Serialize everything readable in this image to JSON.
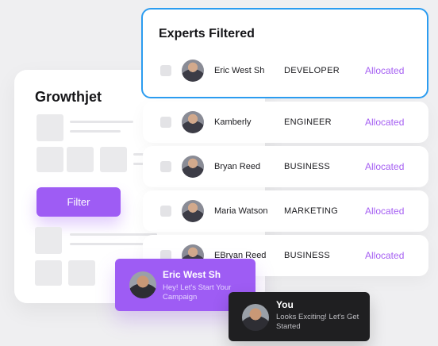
{
  "app": {
    "title": "Growthjet",
    "filter_button": "Filter"
  },
  "experts": {
    "title": "Experts Filtered",
    "rows": [
      {
        "name": "Eric West Sh",
        "role": "DEVELOPER",
        "status": "Allocated"
      },
      {
        "name": "Kamberly",
        "role": "ENGINEER",
        "status": "Allocated"
      },
      {
        "name": "Bryan Reed",
        "role": "BUSINESS",
        "status": "Allocated"
      },
      {
        "name": "Maria Watson",
        "role": "MARKETING",
        "status": "Allocated"
      },
      {
        "name": "EBryan Reed",
        "role": "BUSINESS",
        "status": "Allocated"
      }
    ]
  },
  "chat": {
    "incoming": {
      "name": "Eric West Sh",
      "message": "Hey! Let's Start Your Campaign"
    },
    "outgoing": {
      "name": "You",
      "message": "Looks Exciting! Let's Get Started"
    }
  },
  "colors": {
    "accent": "#9e5cf4",
    "focus_border": "#2b9cf0",
    "status": "#a55ff2",
    "dark_bubble": "#1f1f21"
  }
}
